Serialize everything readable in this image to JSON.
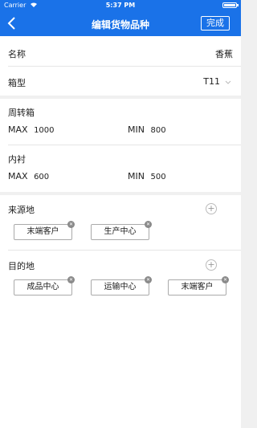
{
  "status": {
    "carrier": "Carrier",
    "time": "5:37 PM"
  },
  "nav": {
    "back_icon": "chevron-left-icon",
    "title": "编辑货物品种",
    "done_label": "完成"
  },
  "name_row": {
    "label": "名称",
    "value": "香蕉"
  },
  "type_row": {
    "label": "箱型",
    "value": "T11"
  },
  "turnover_box": {
    "label": "周转箱",
    "max_label": "MAX",
    "max_value": "1000",
    "min_label": "MIN",
    "min_value": "800"
  },
  "liner": {
    "label": "内衬",
    "max_label": "MAX",
    "max_value": "600",
    "min_label": "MIN",
    "min_value": "500"
  },
  "origin": {
    "label": "来源地",
    "tags": [
      "末端客户",
      "生产中心"
    ]
  },
  "destination": {
    "label": "目的地",
    "tags": [
      "成品中心",
      "运输中心",
      "末端客户"
    ]
  },
  "colors": {
    "primary": "#1a72e8",
    "background": "#f0f0f0"
  }
}
